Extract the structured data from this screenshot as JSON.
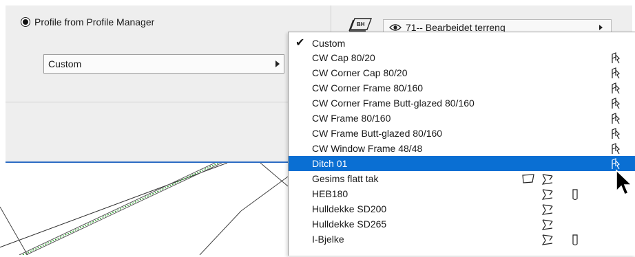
{
  "profile_option": {
    "label": "Profile from Profile Manager",
    "selected": true,
    "current_value": "Custom"
  },
  "layer": {
    "icon": "layer-icon",
    "visibility_icon": "eye-icon",
    "value": "71-- Bearbeidet terreng"
  },
  "menu": {
    "items": [
      {
        "label": "Custom",
        "checked": true,
        "highlight": false,
        "icons": []
      },
      {
        "label": "CW Cap 80/20",
        "checked": false,
        "highlight": false,
        "icons": [
          "wall-tool-icon"
        ]
      },
      {
        "label": "CW Corner Cap 80/20",
        "checked": false,
        "highlight": false,
        "icons": [
          "wall-tool-icon"
        ]
      },
      {
        "label": "CW Corner Frame 80/160",
        "checked": false,
        "highlight": false,
        "icons": [
          "wall-tool-icon"
        ]
      },
      {
        "label": "CW Corner Frame Butt-glazed 80/160",
        "checked": false,
        "highlight": false,
        "icons": [
          "wall-tool-icon"
        ]
      },
      {
        "label": "CW Frame 80/160",
        "checked": false,
        "highlight": false,
        "icons": [
          "wall-tool-icon"
        ]
      },
      {
        "label": "CW Frame Butt-glazed 80/160",
        "checked": false,
        "highlight": false,
        "icons": [
          "wall-tool-icon"
        ]
      },
      {
        "label": "CW Window Frame 48/48",
        "checked": false,
        "highlight": false,
        "icons": [
          "wall-tool-icon"
        ]
      },
      {
        "label": "Ditch 01",
        "checked": false,
        "highlight": true,
        "icons": [
          "wall-tool-icon"
        ]
      },
      {
        "label": "Gesims flatt tak",
        "checked": false,
        "highlight": false,
        "icons": [
          "slab-tool-icon",
          "beam-tool-icon"
        ]
      },
      {
        "label": "HEB180",
        "checked": false,
        "highlight": false,
        "icons": [
          "beam-tool-icon",
          "column-tool-icon"
        ]
      },
      {
        "label": "Hulldekke SD200",
        "checked": false,
        "highlight": false,
        "icons": [
          "beam-tool-icon"
        ]
      },
      {
        "label": "Hulldekke SD265",
        "checked": false,
        "highlight": false,
        "icons": [
          "beam-tool-icon"
        ]
      },
      {
        "label": "I-Bjelke",
        "checked": false,
        "highlight": false,
        "icons": [
          "beam-tool-icon",
          "column-tool-icon"
        ]
      }
    ]
  },
  "colors": {
    "highlight": "#0a6fd3",
    "accent_line": "#2b6cc4",
    "dotted_line": "#2ea02e"
  }
}
